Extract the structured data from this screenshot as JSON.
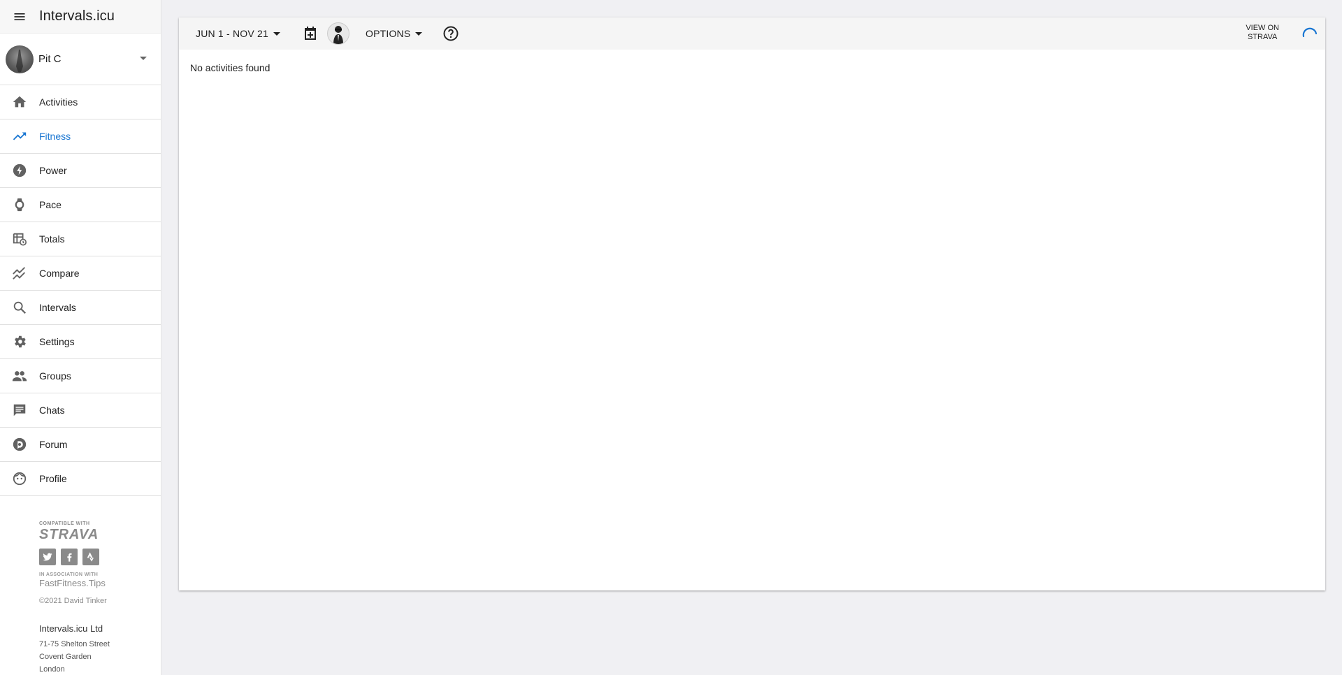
{
  "app": {
    "title": "Intervals.icu"
  },
  "user": {
    "name": "Pit C"
  },
  "nav": {
    "items": [
      {
        "label": "Activities",
        "icon": "home-icon"
      },
      {
        "label": "Fitness",
        "icon": "trending-up-icon",
        "active": true
      },
      {
        "label": "Power",
        "icon": "bolt-icon"
      },
      {
        "label": "Pace",
        "icon": "watch-icon"
      },
      {
        "label": "Totals",
        "icon": "table-clock-icon"
      },
      {
        "label": "Compare",
        "icon": "multiline-chart-icon"
      },
      {
        "label": "Intervals",
        "icon": "search-icon"
      },
      {
        "label": "Settings",
        "icon": "gear-icon"
      },
      {
        "label": "Groups",
        "icon": "people-icon"
      },
      {
        "label": "Chats",
        "icon": "chat-icon"
      },
      {
        "label": "Forum",
        "icon": "discourse-icon"
      },
      {
        "label": "Profile",
        "icon": "face-icon"
      }
    ]
  },
  "footer": {
    "compatible_with": "COMPATIBLE WITH",
    "strava": "STRAVA",
    "in_association_with": "IN ASSOCIATION WITH",
    "fastfitness": "FastFitness.Tips",
    "copyright": "©2021 David Tinker",
    "company": "Intervals.icu Ltd",
    "address_line1": "71-75 Shelton Street",
    "address_line2": "Covent Garden",
    "address_line3": "London"
  },
  "toolbar": {
    "date_range": "JUN 1 - NOV 21",
    "options_label": "OPTIONS",
    "view_on": "VIEW ON",
    "strava": "STRAVA"
  },
  "main": {
    "empty_message": "No activities found"
  },
  "colors": {
    "accent": "#1976d2",
    "icon_gray": "#616161"
  }
}
